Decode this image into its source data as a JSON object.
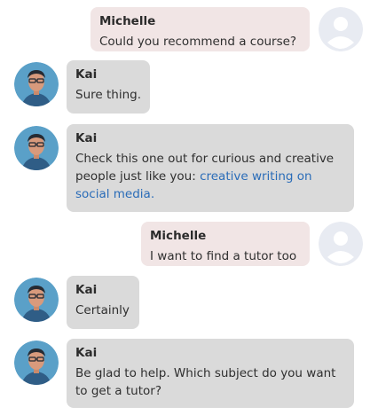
{
  "messages": [
    {
      "sender": "Michelle",
      "role": "user",
      "text": "Could you recommend a course?"
    },
    {
      "sender": "Kai",
      "role": "bot",
      "text": "Sure thing."
    },
    {
      "sender": "Kai",
      "role": "bot",
      "text_before_link": "Check this one out for curious and creative people just like you: ",
      "link_text": "creative writing on social media."
    },
    {
      "sender": "Michelle",
      "role": "user",
      "text": "I want to find a tutor too"
    },
    {
      "sender": "Kai",
      "role": "bot",
      "text": "Certainly"
    },
    {
      "sender": "Kai",
      "role": "bot",
      "text": "Be glad to help. Which subject do you want to get a tutor?"
    }
  ],
  "icons": {
    "user_avatar": "user-placeholder-icon",
    "bot_avatar": "kai-avatar-icon"
  },
  "colors": {
    "user_bubble": "#f1e5e5",
    "bot_bubble": "#dadada",
    "link": "#2a6cb8",
    "avatar_bg_user": "#e8ebf2",
    "avatar_bg_bot": "#5aa0c8"
  }
}
